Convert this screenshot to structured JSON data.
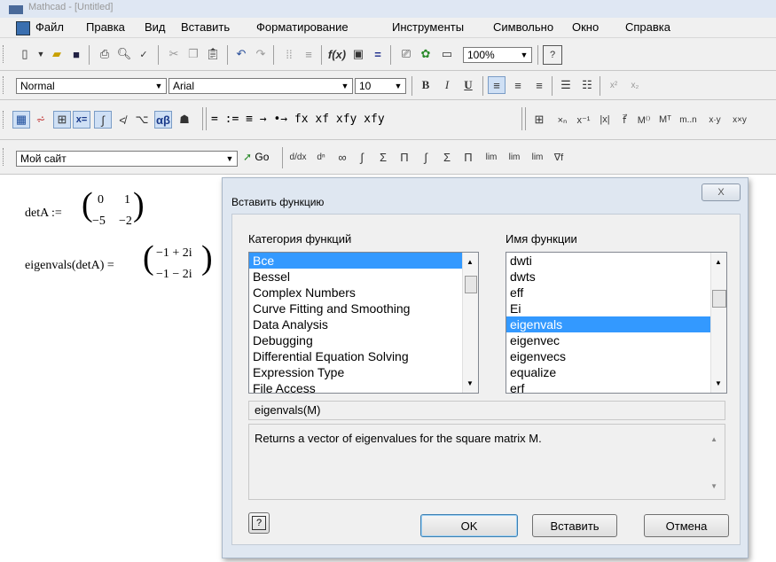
{
  "window": {
    "title": "Mathcad - [Untitled]"
  },
  "menu": [
    "Файл",
    "Правка",
    "Вид",
    "Вставить",
    "Форматирование",
    "Инструменты",
    "Символьно",
    "Окно",
    "Справка"
  ],
  "format_bar": {
    "style": "Normal",
    "font": "Arial",
    "size": "10",
    "bold": "B",
    "italic": "I",
    "underline": "U"
  },
  "zoom": "100%",
  "resources": {
    "selected": "Мой сайт",
    "go_label": "Go"
  },
  "math_toolbar": {
    "defs": "=  :=  ≡  →  •→  fx  xf  xfy  xfy"
  },
  "worksheet": {
    "expr1_lhs": "detA :=",
    "matrix1": [
      "0",
      "1",
      "−5",
      "−2"
    ],
    "expr2_lhs": "eigenvals(detA) =",
    "result": [
      "−1 + 2i",
      "−1 − 2i"
    ]
  },
  "dialog": {
    "title": "Вставить функцию",
    "category_label": "Категория функций",
    "name_label": "Имя функции",
    "categories": [
      "Все",
      "Bessel",
      "Complex Numbers",
      "Curve Fitting and Smoothing",
      "Data Analysis",
      "Debugging",
      "Differential Equation Solving",
      "Expression Type",
      "File Access"
    ],
    "functions": [
      "dwti",
      "dwts",
      "eff",
      "Ei",
      "eigenvals",
      "eigenvec",
      "eigenvecs",
      "equalize",
      "erf"
    ],
    "selected_function": "eigenvals",
    "signature": "eigenvals(M)",
    "description": "Returns a vector of eigenvalues for the square matrix M.",
    "ok_label": "OK",
    "insert_label": "Вставить",
    "cancel_label": "Отмена",
    "close_label": "X"
  }
}
